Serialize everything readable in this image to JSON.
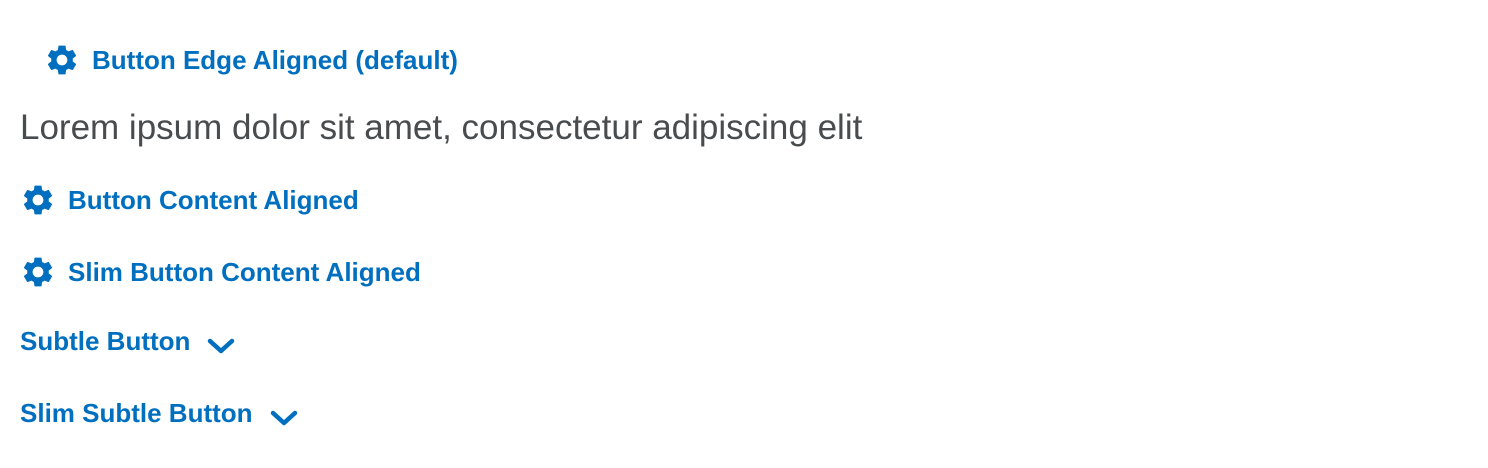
{
  "buttons": {
    "edge_aligned": {
      "label": "Button Edge Aligned (default)",
      "icon": "gear-icon"
    },
    "content_aligned": {
      "label": "Button Content Aligned",
      "icon": "gear-icon"
    },
    "slim_content_aligned": {
      "label": "Slim Button Content Aligned",
      "icon": "gear-icon"
    },
    "subtle": {
      "label": "Subtle Button",
      "icon": "chevron-down-icon"
    },
    "slim_subtle": {
      "label": "Slim Subtle Button",
      "icon": "chevron-down-icon"
    }
  },
  "body_text": "Lorem ipsum dolor sit amet, consectetur adipiscing elit",
  "colors": {
    "accent": "#006fbf",
    "text": "#494c4e",
    "background": "#ffffff"
  }
}
